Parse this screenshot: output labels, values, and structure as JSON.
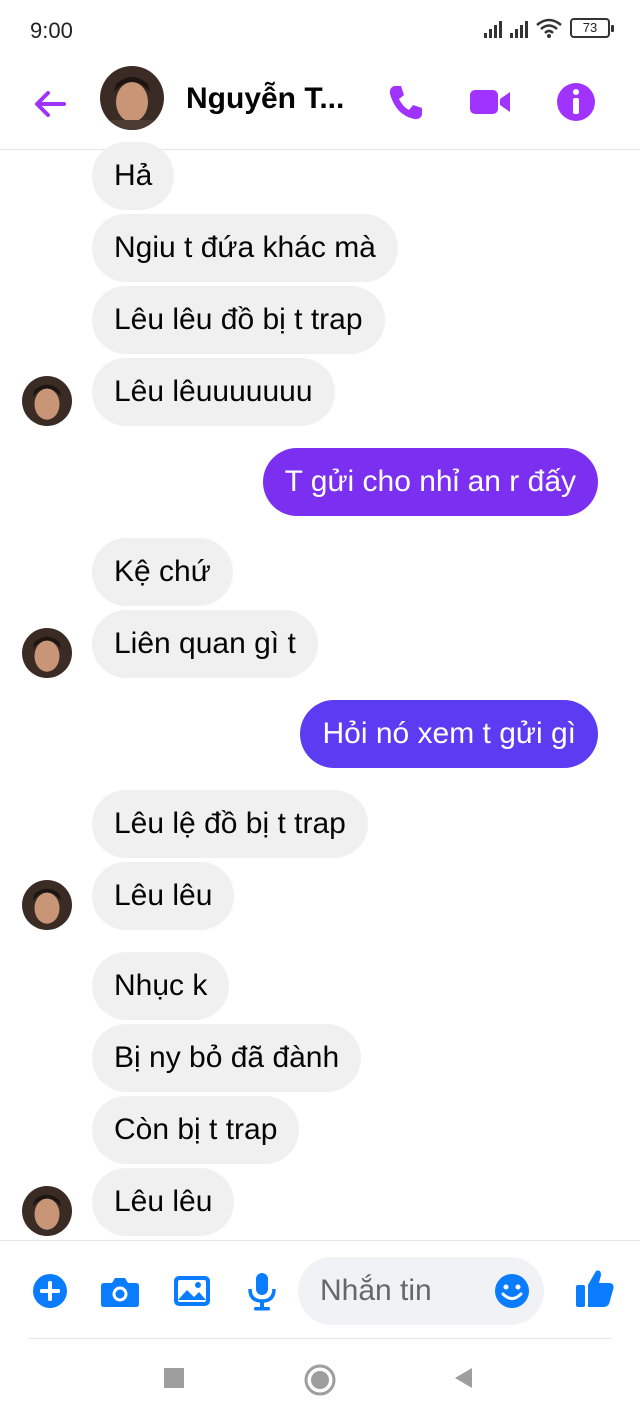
{
  "status_bar": {
    "time": "9:00",
    "battery": "73",
    "icons": [
      "signal-icon",
      "signal-icon",
      "wifi-icon",
      "battery-icon"
    ]
  },
  "header": {
    "name": "Nguyễn T...",
    "icons": [
      "back-arrow-icon",
      "phone-icon",
      "video-camera-icon",
      "info-icon"
    ],
    "accent_color": "#a033ff"
  },
  "messages": [
    {
      "from": "them",
      "text": "Hả"
    },
    {
      "from": "them",
      "text": "Ngiu t đứa khác mà"
    },
    {
      "from": "them",
      "text": "Lêu lêu đồ bị t trap"
    },
    {
      "from": "them",
      "text": "Lêu lêuuuuuuu"
    },
    {
      "from": "me",
      "text": "T gửi cho nhỉ an r đấy"
    },
    {
      "from": "them",
      "text": "Kệ chứ"
    },
    {
      "from": "them",
      "text": "Liên quan gì t"
    },
    {
      "from": "me",
      "text": "Hỏi nó xem t gửi gì"
    },
    {
      "from": "them",
      "text": "Lêu lệ đồ bị t trap"
    },
    {
      "from": "them",
      "text": "Lêu lêu"
    },
    {
      "from": "them",
      "text": "Nhục k"
    },
    {
      "from": "them",
      "text": "Bị ny bỏ đã đành"
    },
    {
      "from": "them",
      "text": "Còn bị t trap"
    },
    {
      "from": "them",
      "text": "Lêu lêu"
    }
  ],
  "composer": {
    "placeholder": "Nhắn tin",
    "icons": [
      "plus-icon",
      "camera-icon",
      "image-icon",
      "microphone-icon",
      "emoji-icon",
      "thumbs-up-icon"
    ],
    "icon_color": "#0a7cff"
  },
  "nav_bar": {
    "icons": [
      "recents-square-icon",
      "home-circle-icon",
      "back-triangle-icon"
    ]
  },
  "colors": {
    "incoming_bubble": "#f0f0f0",
    "outgoing_bubble_1": "#7b2ff0",
    "outgoing_bubble_2": "#5b3cf2"
  }
}
